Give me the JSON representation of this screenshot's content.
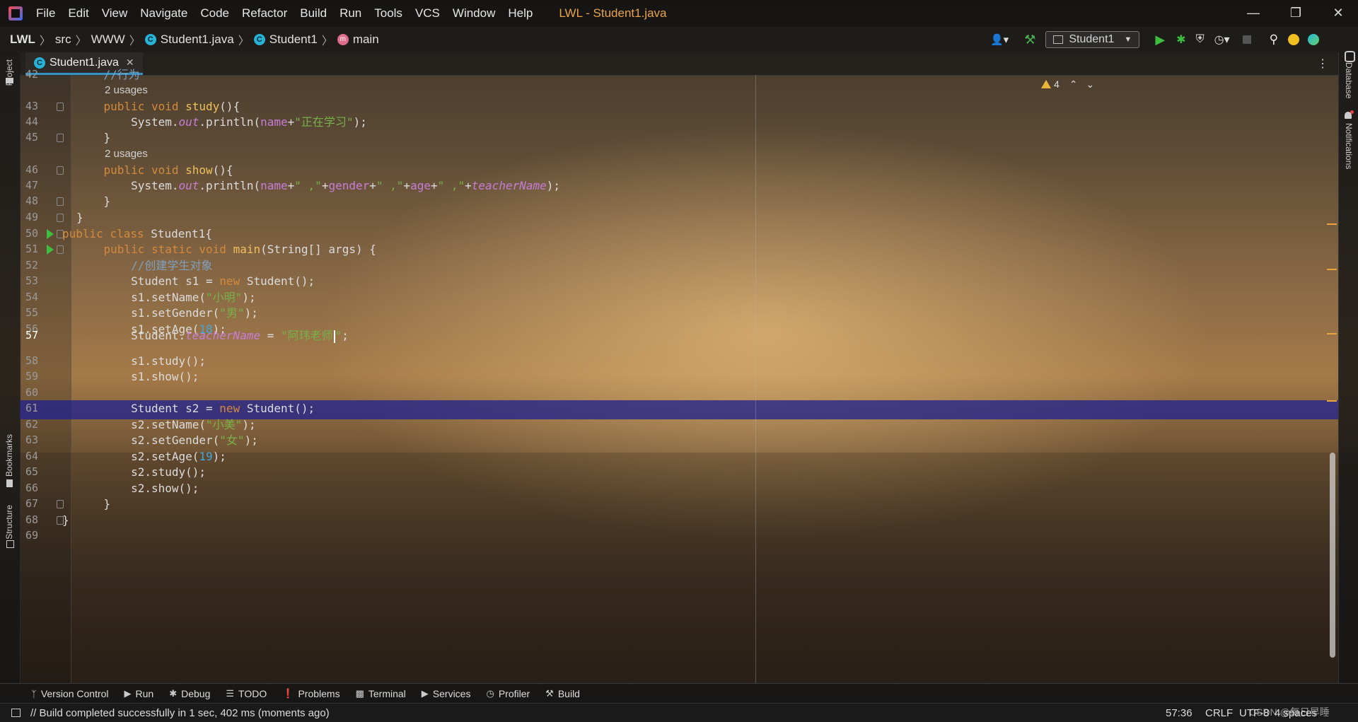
{
  "window": {
    "title": "LWL - Student1.java",
    "menu": [
      "File",
      "Edit",
      "View",
      "Navigate",
      "Code",
      "Refactor",
      "Build",
      "Run",
      "Tools",
      "VCS",
      "Window",
      "Help"
    ]
  },
  "navbar": {
    "breadcrumbs": [
      "LWL",
      "src",
      "WWW",
      "Student1.java",
      "Student1",
      "main"
    ],
    "run_config": "Student1"
  },
  "tabs": [
    {
      "label": "Student1.java"
    }
  ],
  "left_tools": [
    "Project",
    "Bookmarks",
    "Structure"
  ],
  "right_tools": [
    "Database",
    "Notifications"
  ],
  "inspection": {
    "warnings": "4"
  },
  "editor": {
    "lines": [
      {
        "n": "42",
        "text": "    //行为"
      },
      {
        "n": "",
        "usage": "2 usages"
      },
      {
        "n": "43",
        "text": "    public void study(){"
      },
      {
        "n": "44",
        "text": "        System.out.println(name+\"正在学习\");"
      },
      {
        "n": "45",
        "text": "    }"
      },
      {
        "n": "",
        "usage": "2 usages"
      },
      {
        "n": "46",
        "text": "    public void show(){"
      },
      {
        "n": "47",
        "text": "        System.out.println(name+\" ,\"+gender+\" ,\"+age+\" ,\"+teacherName);"
      },
      {
        "n": "48",
        "text": "    }"
      },
      {
        "n": "49",
        "text": "}"
      },
      {
        "n": "50",
        "text": "public class Student1{"
      },
      {
        "n": "51",
        "text": "    public static void main(String[] args) {"
      },
      {
        "n": "52",
        "text": "        //创建学生对象"
      },
      {
        "n": "53",
        "text": "        Student s1 = new Student();"
      },
      {
        "n": "54",
        "text": "        s1.setName(\"小明\");"
      },
      {
        "n": "55",
        "text": "        s1.setGender(\"男\");"
      },
      {
        "n": "56",
        "text": "        s1.setAge(18);"
      },
      {
        "n": "57",
        "text": "        Student.teacherName = \"阿玮老师\";"
      },
      {
        "n": "58",
        "text": "        s1.study();"
      },
      {
        "n": "59",
        "text": "        s1.show();"
      },
      {
        "n": "60",
        "text": ""
      },
      {
        "n": "61",
        "text": "        Student s2 = new Student();"
      },
      {
        "n": "62",
        "text": "        s2.setName(\"小美\");"
      },
      {
        "n": "63",
        "text": "        s2.setGender(\"女\");"
      },
      {
        "n": "64",
        "text": "        s2.setAge(19);"
      },
      {
        "n": "65",
        "text": "        s2.study();"
      },
      {
        "n": "66",
        "text": "        s2.show();"
      },
      {
        "n": "67",
        "text": "    }"
      },
      {
        "n": "68",
        "text": "}"
      },
      {
        "n": "69",
        "text": ""
      }
    ]
  },
  "bottom_tools": [
    "Version Control",
    "Run",
    "Debug",
    "TODO",
    "Problems",
    "Terminal",
    "Services",
    "Profiler",
    "Build"
  ],
  "status": {
    "message": "// Build completed successfully in 1 sec, 402 ms (moments ago)",
    "position": "57:36",
    "line_sep": "CRLF",
    "encoding": "UTF-8",
    "indent": "4 spaces",
    "watermark": "CSDN @每日早睡"
  },
  "colors": {
    "keyword": "#d48a3c",
    "string": "#78b14a",
    "number": "#3fa8e0",
    "field": "#c77dd7",
    "method": "#f0c05a",
    "comment": "#7fa0bf",
    "highlight": "#23238c"
  }
}
